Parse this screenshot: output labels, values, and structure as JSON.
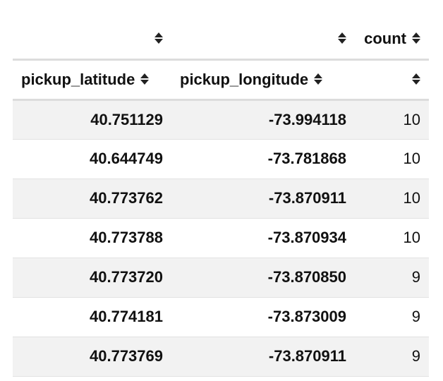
{
  "header": {
    "top_row": {
      "col1": "",
      "col2": "",
      "col3": "count"
    },
    "bottom_row": {
      "col1": "pickup_latitude",
      "col2": "pickup_longitude",
      "col3": ""
    },
    "sort_icon": "sort-up-down-icon"
  },
  "rows": [
    {
      "pickup_latitude": "40.751129",
      "pickup_longitude": "-73.994118",
      "count": "10"
    },
    {
      "pickup_latitude": "40.644749",
      "pickup_longitude": "-73.781868",
      "count": "10"
    },
    {
      "pickup_latitude": "40.773762",
      "pickup_longitude": "-73.870911",
      "count": "10"
    },
    {
      "pickup_latitude": "40.773788",
      "pickup_longitude": "-73.870934",
      "count": "10"
    },
    {
      "pickup_latitude": "40.773720",
      "pickup_longitude": "-73.870850",
      "count": "9"
    },
    {
      "pickup_latitude": "40.774181",
      "pickup_longitude": "-73.873009",
      "count": "9"
    },
    {
      "pickup_latitude": "40.773769",
      "pickup_longitude": "-73.870911",
      "count": "9"
    }
  ],
  "colors": {
    "stripe": "#f2f2f2",
    "header_border": "#dcdcdc",
    "text": "#111111"
  }
}
